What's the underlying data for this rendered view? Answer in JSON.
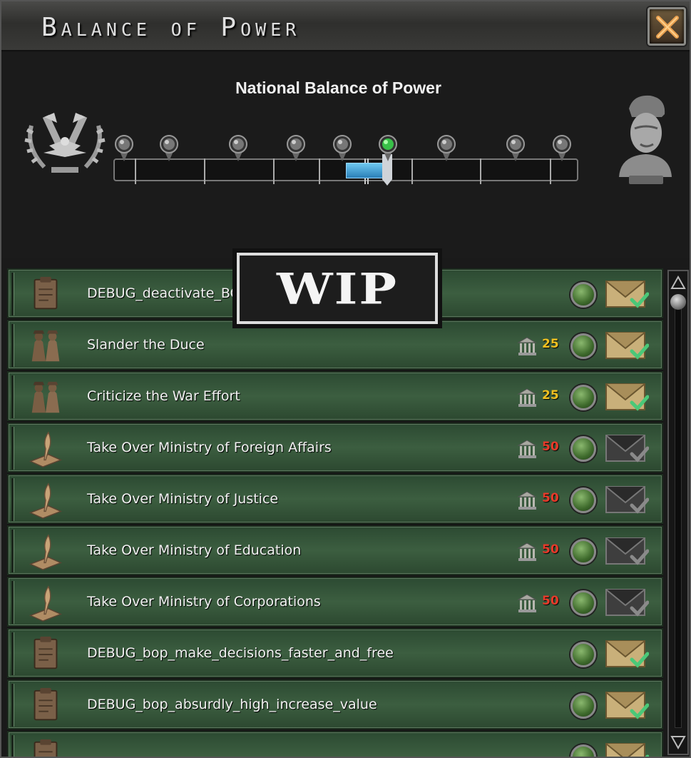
{
  "window": {
    "title": "Balance of Power",
    "close_label": "close"
  },
  "bop": {
    "heading": "National Balance of Power",
    "left_side_icon": "fascist-eagle-emblem",
    "right_side_icon": "duce-bust-portrait",
    "current_value_fraction": 0.59,
    "wip_label": "WIP"
  },
  "colors": {
    "row_green": "#3c5e40",
    "cost_yellow": "#f0c020",
    "cost_red": "#e83a2a",
    "bar_blue": "#4aa8dc"
  },
  "decisions": [
    {
      "label": "DEBUG_deactivate_BOP",
      "icon": "clipboard-icon",
      "cost": "",
      "cost_color": "",
      "envelope": "tan"
    },
    {
      "label": "Slander the Duce",
      "icon": "agents-icon",
      "cost": "25",
      "cost_color": "yellow",
      "envelope": "tan"
    },
    {
      "label": "Criticize the War Effort",
      "icon": "agents-icon",
      "cost": "25",
      "cost_color": "yellow",
      "envelope": "tan"
    },
    {
      "label": "Take Over Ministry of Foreign Affairs",
      "icon": "quill-icon",
      "cost": "50",
      "cost_color": "red",
      "envelope": "dark"
    },
    {
      "label": "Take Over Ministry of Justice",
      "icon": "quill-icon",
      "cost": "50",
      "cost_color": "red",
      "envelope": "dark"
    },
    {
      "label": "Take Over Ministry of Education",
      "icon": "quill-icon",
      "cost": "50",
      "cost_color": "red",
      "envelope": "dark"
    },
    {
      "label": "Take Over Ministry of Corporations",
      "icon": "quill-icon",
      "cost": "50",
      "cost_color": "red",
      "envelope": "dark"
    },
    {
      "label": "DEBUG_bop_make_decisions_faster_and_free",
      "icon": "clipboard-icon",
      "cost": "",
      "cost_color": "",
      "envelope": "tan"
    },
    {
      "label": "DEBUG_bop_absurdly_high_increase_value",
      "icon": "clipboard-icon",
      "cost": "",
      "cost_color": "",
      "envelope": "tan"
    },
    {
      "label": "",
      "icon": "clipboard-icon",
      "cost": "",
      "cost_color": "",
      "envelope": "tan"
    }
  ]
}
